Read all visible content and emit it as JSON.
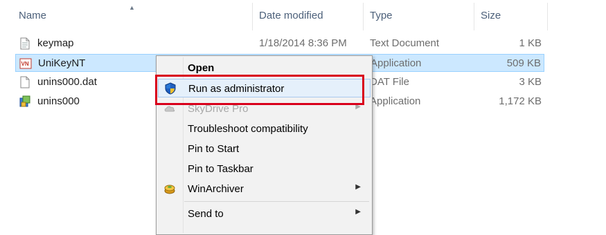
{
  "columns": {
    "name": "Name",
    "date_modified": "Date modified",
    "type": "Type",
    "size": "Size"
  },
  "files": [
    {
      "name": "keymap",
      "date": "1/18/2014 8:36 PM",
      "type": "Text Document",
      "size": "1 KB",
      "icon": "text-file-icon"
    },
    {
      "name": "UniKeyNT",
      "date": "",
      "type": "Application",
      "size": "509 KB",
      "icon": "unikey-app-icon",
      "selected": true
    },
    {
      "name": "unins000.dat",
      "date": "",
      "type": "DAT File",
      "size": "3 KB",
      "icon": "dat-file-icon"
    },
    {
      "name": "unins000",
      "date": "",
      "type": "Application",
      "size": "1,172 KB",
      "icon": "uninstaller-icon"
    }
  ],
  "context_menu": {
    "open": "Open",
    "run_as_admin": "Run as administrator",
    "skydrive": "SkyDrive Pro",
    "troubleshoot": "Troubleshoot compatibility",
    "pin_start": "Pin to Start",
    "pin_taskbar": "Pin to Taskbar",
    "winarchiver": "WinArchiver",
    "send_to": "Send to"
  },
  "colors": {
    "highlight_box": "#d9001b",
    "selection": "#cce8ff"
  }
}
